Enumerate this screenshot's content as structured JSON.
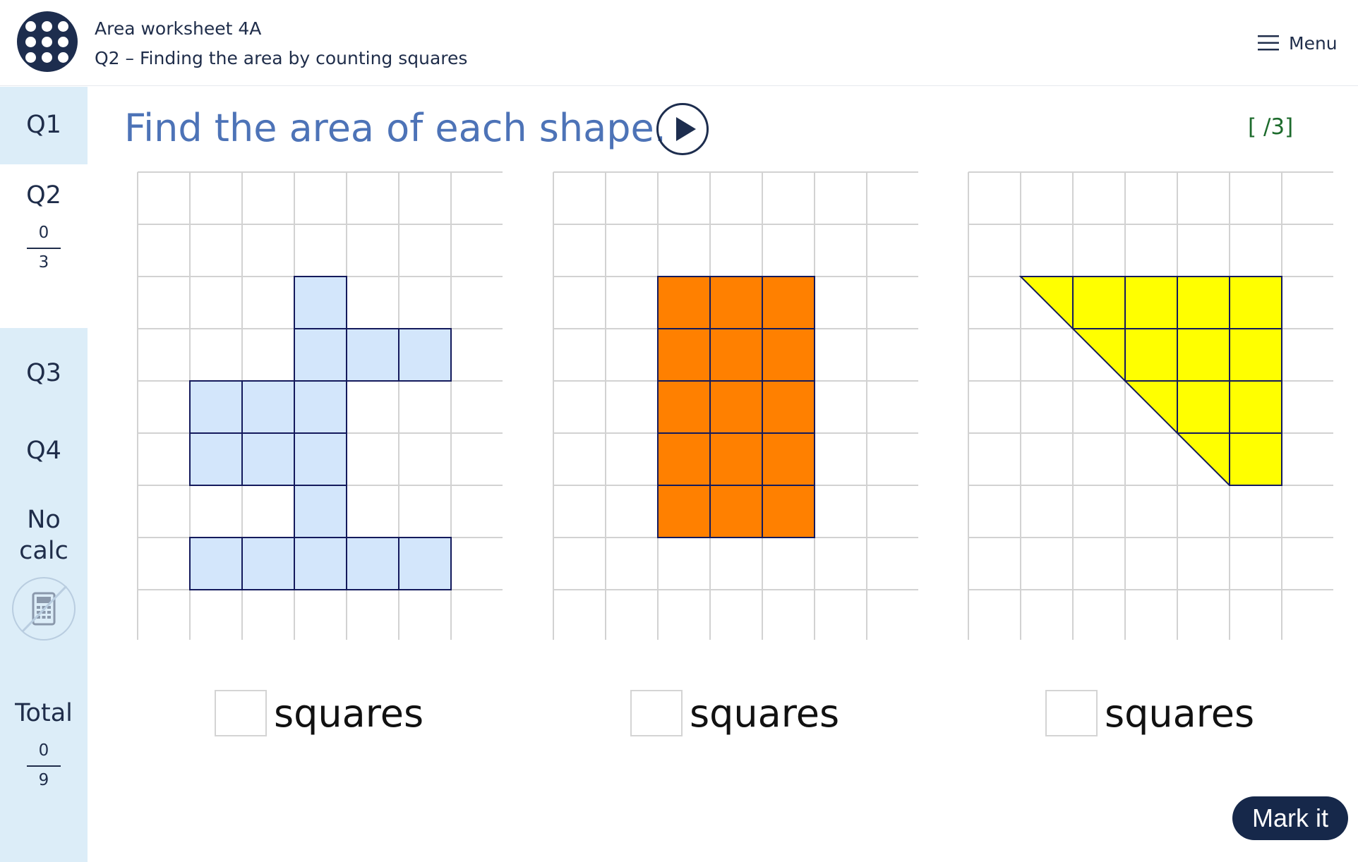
{
  "header": {
    "title": "Area worksheet 4A",
    "subtitle": "Q2 – Finding the area by counting squares",
    "menu_label": "Menu"
  },
  "sidebar": {
    "q1": "Q1",
    "q2": "Q2",
    "q2_score": "0",
    "q2_max": "3",
    "q3": "Q3",
    "q4": "Q4",
    "nocalc_line1": "No",
    "nocalc_line2": "calc",
    "total_label": "Total",
    "total_score": "0",
    "total_max": "9"
  },
  "question": {
    "prompt": "Find the area of each shape.",
    "marks": "[  /3]"
  },
  "shapes": [
    {
      "fill": "#d3e6fb",
      "unit": "squares",
      "answer": ""
    },
    {
      "fill": "#ff8000",
      "unit": "squares",
      "answer": ""
    },
    {
      "fill": "#ffff00",
      "unit": "squares",
      "answer": ""
    }
  ],
  "colors": {
    "brand_dark": "#1d2d4e",
    "prompt_blue": "#4d73b7",
    "sidebar_bg": "#dcedf8",
    "score_green": "#1d6b2c"
  },
  "mark_button": "Mark it"
}
